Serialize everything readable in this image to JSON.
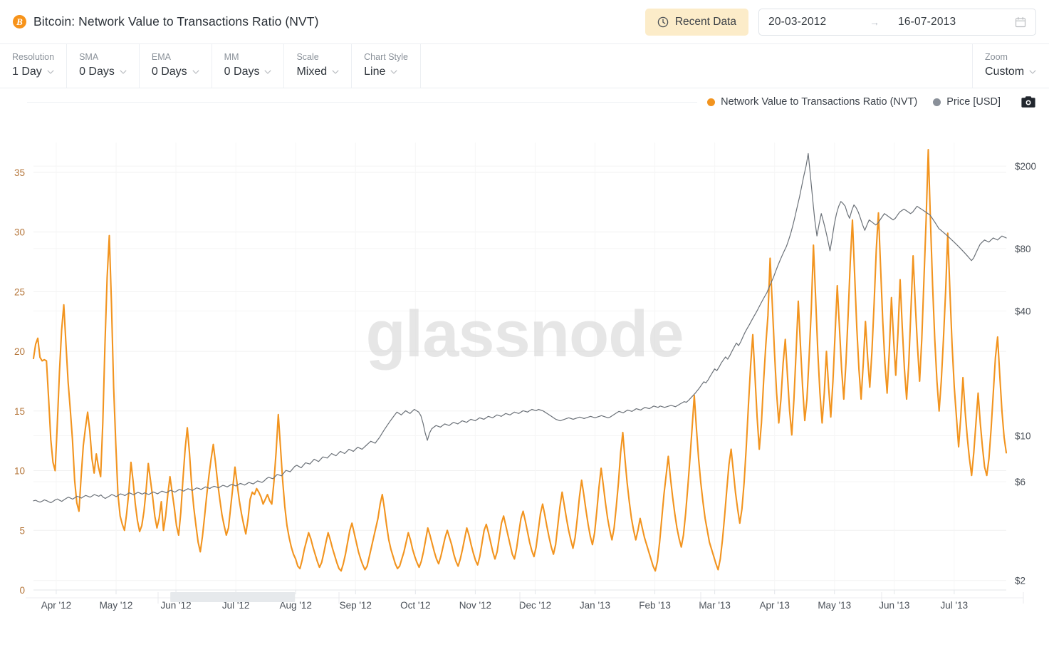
{
  "header": {
    "icon": "bitcoin-icon",
    "title": "Bitcoin: Network Value to Transactions Ratio (NVT)",
    "recent_data_label": "Recent Data",
    "recent_data_icon": "clock-icon",
    "date_from": "20-03-2012",
    "date_arrow": "→",
    "date_to": "16-07-2013",
    "calendar_icon": "calendar-icon"
  },
  "toolbar": {
    "items": [
      {
        "label": "Resolution",
        "value": "1 Day"
      },
      {
        "label": "SMA",
        "value": "0 Days"
      },
      {
        "label": "EMA",
        "value": "0 Days"
      },
      {
        "label": "MM",
        "value": "0 Days"
      },
      {
        "label": "Scale",
        "value": "Mixed"
      },
      {
        "label": "Chart Style",
        "value": "Line"
      }
    ],
    "zoom": {
      "label": "Zoom",
      "value": "Custom"
    }
  },
  "legend": {
    "items": [
      {
        "label": "Network Value to Transactions Ratio (NVT)",
        "color": "#f2941f"
      },
      {
        "label": "Price [USD]",
        "color": "#8a9099"
      }
    ],
    "camera_icon": "camera-icon"
  },
  "watermark": "glassnode",
  "chart_data": {
    "type": "line",
    "title": "Bitcoin: Network Value to Transactions Ratio (NVT)",
    "xlabel": "",
    "ylabel": "Network Value to Transactions Ratio (NVT)",
    "y2label": "Price [USD]",
    "grid": true,
    "legend_position": "top-right",
    "x_tick_labels": [
      "Apr '12",
      "May '12",
      "Jun '12",
      "Jul '12",
      "Aug '12",
      "Sep '12",
      "Oct '12",
      "Nov '12",
      "Dec '12",
      "Jan '13",
      "Feb '13",
      "Mar '13",
      "Apr '13",
      "May '13",
      "Jun '13",
      "Jul '13"
    ],
    "x_range": [
      "2012-03-20",
      "2013-07-16"
    ],
    "y_left": {
      "label": "NVT",
      "scale": "linear",
      "ticks": [
        0,
        5,
        10,
        15,
        20,
        25,
        30,
        35
      ],
      "ylim": [
        0,
        37.5
      ],
      "color": "#b5763a"
    },
    "y_right": {
      "label": "Price [USD]",
      "scale": "log",
      "ticks": [
        2,
        6,
        10,
        40,
        80,
        200
      ],
      "tick_labels": [
        "$2",
        "$6",
        "$10",
        "$40",
        "$80",
        "$200"
      ],
      "ylim": [
        1.8,
        260
      ],
      "color": "#4a5058"
    },
    "series": [
      {
        "name": "Network Value to Transactions Ratio (NVT)",
        "axis": "left",
        "color": "#f2941f",
        "width": 2.1,
        "values": [
          19.4,
          20.6,
          21.1,
          19.5,
          19.2,
          19.3,
          19.2,
          16.0,
          12.6,
          10.7,
          10.0,
          13.9,
          18.3,
          21.8,
          23.9,
          20.6,
          17.4,
          15.1,
          12.6,
          9.2,
          7.3,
          6.6,
          9.5,
          12.1,
          13.6,
          14.9,
          13.3,
          11.0,
          9.8,
          11.4,
          10.3,
          9.5,
          14.0,
          20.6,
          26.2,
          29.7,
          24.0,
          17.0,
          12.2,
          8.0,
          6.2,
          5.5,
          5.0,
          6.4,
          8.2,
          10.7,
          9.1,
          7.2,
          5.8,
          4.9,
          5.4,
          6.6,
          8.4,
          10.6,
          9.2,
          7.8,
          6.2,
          5.2,
          6.0,
          7.4,
          5.0,
          6.2,
          8.0,
          9.5,
          8.2,
          6.9,
          5.4,
          4.6,
          6.5,
          9.3,
          11.8,
          13.6,
          11.5,
          8.8,
          6.9,
          5.4,
          4.0,
          3.2,
          4.5,
          6.2,
          8.0,
          9.6,
          11.0,
          12.2,
          10.7,
          9.0,
          7.6,
          6.3,
          5.4,
          4.6,
          5.2,
          6.9,
          8.6,
          10.3,
          8.9,
          7.5,
          6.4,
          5.5,
          4.7,
          5.9,
          7.6,
          8.2,
          8.0,
          8.5,
          8.2,
          7.8,
          7.2,
          7.6,
          8.0,
          7.5,
          7.2,
          9.1,
          11.6,
          14.7,
          12.0,
          9.2,
          7.0,
          5.4,
          4.4,
          3.6,
          3.0,
          2.6,
          2.0,
          1.8,
          2.5,
          3.4,
          4.1,
          4.8,
          4.3,
          3.6,
          3.0,
          2.4,
          1.9,
          2.3,
          3.1,
          4.0,
          4.8,
          4.2,
          3.5,
          2.9,
          2.3,
          1.8,
          1.6,
          2.2,
          3.0,
          4.0,
          5.0,
          5.6,
          4.8,
          4.0,
          3.2,
          2.6,
          2.1,
          1.7,
          2.0,
          2.8,
          3.6,
          4.4,
          5.2,
          6.0,
          7.2,
          8.0,
          6.8,
          5.4,
          4.2,
          3.4,
          2.8,
          2.2,
          1.8,
          2.0,
          2.6,
          3.2,
          4.0,
          4.8,
          4.2,
          3.4,
          2.8,
          2.3,
          1.9,
          2.4,
          3.2,
          4.2,
          5.2,
          4.6,
          3.9,
          3.2,
          2.6,
          2.2,
          2.8,
          3.6,
          4.4,
          5.0,
          4.4,
          3.8,
          3.0,
          2.4,
          2.0,
          2.6,
          3.4,
          4.3,
          5.2,
          4.6,
          3.8,
          3.1,
          2.5,
          2.1,
          2.8,
          3.9,
          5.0,
          5.5,
          4.8,
          4.0,
          3.2,
          2.6,
          3.2,
          4.4,
          5.6,
          6.2,
          5.4,
          4.6,
          3.8,
          3.0,
          2.6,
          3.5,
          4.8,
          6.0,
          6.6,
          5.8,
          4.9,
          4.0,
          3.3,
          2.8,
          3.6,
          5.0,
          6.4,
          7.2,
          6.3,
          5.3,
          4.4,
          3.6,
          3.0,
          3.8,
          5.4,
          7.0,
          8.2,
          7.1,
          6.0,
          5.0,
          4.2,
          3.5,
          4.4,
          6.0,
          7.8,
          9.2,
          8.0,
          6.7,
          5.5,
          4.5,
          3.8,
          4.8,
          6.6,
          8.6,
          10.2,
          8.8,
          7.3,
          6.0,
          5.0,
          4.2,
          5.2,
          7.0,
          9.0,
          11.5,
          13.2,
          11.0,
          9.0,
          7.4,
          6.0,
          5.0,
          4.2,
          5.0,
          6.0,
          5.2,
          4.4,
          3.8,
          3.2,
          2.6,
          2.0,
          1.6,
          2.4,
          4.0,
          6.0,
          8.0,
          9.6,
          11.2,
          9.4,
          7.8,
          6.4,
          5.2,
          4.3,
          3.6,
          4.6,
          6.4,
          8.6,
          11.0,
          13.6,
          16.3,
          13.5,
          11.0,
          9.0,
          7.4,
          6.0,
          5.0,
          4.0,
          3.4,
          2.8,
          2.2,
          1.7,
          2.6,
          4.2,
          6.2,
          8.4,
          10.5,
          11.8,
          10.0,
          8.2,
          6.8,
          5.6,
          6.8,
          9.0,
          12.0,
          15.5,
          18.8,
          21.4,
          18.0,
          14.5,
          11.8,
          14.0,
          17.5,
          20.5,
          23.0,
          27.8,
          24.0,
          20.0,
          16.5,
          14.0,
          16.0,
          19.0,
          21.0,
          18.0,
          15.0,
          13.0,
          16.0,
          20.0,
          24.2,
          20.5,
          17.0,
          14.2,
          16.0,
          19.5,
          23.5,
          28.9,
          24.5,
          20.0,
          16.5,
          14.0,
          16.5,
          20.0,
          17.0,
          14.5,
          17.5,
          21.5,
          25.5,
          22.0,
          18.5,
          16.0,
          19.0,
          23.0,
          27.5,
          31.0,
          26.5,
          22.0,
          18.5,
          16.0,
          19.0,
          22.5,
          19.5,
          17.0,
          20.0,
          24.0,
          28.5,
          31.6,
          27.0,
          22.5,
          19.0,
          16.5,
          20.0,
          24.5,
          21.0,
          18.0,
          21.5,
          26.0,
          22.0,
          18.5,
          16.0,
          19.0,
          23.5,
          28.0,
          24.0,
          20.5,
          17.5,
          21.0,
          26.0,
          31.0,
          36.9,
          31.0,
          25.5,
          21.0,
          17.5,
          15.0,
          17.5,
          21.0,
          25.0,
          29.9,
          25.0,
          20.5,
          17.0,
          14.5,
          12.0,
          14.5,
          17.8,
          15.0,
          12.8,
          11.0,
          9.6,
          11.5,
          14.0,
          16.5,
          14.0,
          12.0,
          10.3,
          9.6,
          11.0,
          13.5,
          16.5,
          19.5,
          21.2,
          18.0,
          15.0,
          12.8,
          11.5
        ]
      },
      {
        "name": "Price [USD]",
        "axis": "right",
        "color": "#6b7178",
        "width": 1.2,
        "values": [
          4.85,
          4.88,
          4.82,
          4.78,
          4.83,
          4.9,
          4.86,
          4.8,
          4.75,
          4.82,
          4.9,
          4.95,
          4.88,
          4.82,
          4.9,
          4.98,
          5.05,
          5.0,
          4.94,
          5.02,
          5.1,
          5.06,
          5.0,
          5.08,
          5.15,
          5.1,
          5.05,
          5.12,
          5.2,
          5.15,
          5.1,
          5.18,
          5.05,
          4.98,
          5.05,
          5.12,
          5.2,
          5.15,
          5.08,
          5.16,
          5.24,
          5.2,
          5.14,
          5.22,
          5.3,
          5.25,
          5.18,
          5.26,
          5.33,
          5.28,
          5.22,
          5.3,
          5.25,
          5.2,
          5.28,
          5.35,
          5.3,
          5.24,
          5.32,
          5.4,
          5.36,
          5.3,
          5.38,
          5.45,
          5.4,
          5.34,
          5.42,
          5.5,
          5.46,
          5.4,
          5.48,
          5.55,
          5.5,
          5.44,
          5.52,
          5.6,
          5.56,
          5.5,
          5.58,
          5.66,
          5.62,
          5.56,
          5.64,
          5.7,
          5.66,
          5.6,
          5.68,
          5.76,
          5.72,
          5.66,
          5.74,
          5.82,
          5.78,
          5.72,
          5.8,
          5.88,
          5.84,
          5.78,
          5.86,
          5.95,
          5.9,
          5.85,
          5.95,
          6.05,
          6.0,
          5.95,
          6.05,
          6.2,
          6.3,
          6.25,
          6.2,
          6.35,
          6.5,
          6.45,
          6.4,
          6.6,
          6.8,
          6.75,
          6.7,
          6.9,
          7.1,
          7.2,
          7.1,
          7.0,
          7.2,
          7.4,
          7.35,
          7.3,
          7.5,
          7.7,
          7.6,
          7.5,
          7.7,
          7.9,
          7.85,
          7.8,
          8.0,
          8.2,
          8.1,
          8.0,
          8.2,
          8.4,
          8.3,
          8.2,
          8.4,
          8.6,
          8.5,
          8.4,
          8.6,
          8.8,
          8.7,
          8.6,
          8.8,
          9.0,
          9.2,
          9.4,
          9.3,
          9.2,
          9.5,
          9.8,
          10.2,
          10.6,
          11.0,
          11.4,
          11.8,
          12.2,
          12.6,
          13.0,
          12.8,
          12.6,
          12.9,
          13.2,
          13.0,
          12.8,
          13.1,
          13.4,
          13.2,
          13.0,
          12.5,
          11.5,
          10.3,
          9.5,
          10.3,
          10.8,
          11.0,
          11.2,
          11.1,
          11.0,
          11.2,
          11.4,
          11.3,
          11.2,
          11.4,
          11.6,
          11.5,
          11.4,
          11.6,
          11.8,
          11.7,
          11.6,
          11.8,
          12.0,
          11.9,
          11.8,
          12.0,
          12.2,
          12.1,
          12.0,
          12.2,
          12.4,
          12.3,
          12.2,
          12.4,
          12.6,
          12.5,
          12.4,
          12.6,
          12.8,
          12.7,
          12.6,
          12.8,
          13.0,
          12.9,
          12.8,
          13.0,
          13.2,
          13.1,
          13.0,
          13.2,
          13.4,
          13.3,
          13.2,
          13.4,
          13.3,
          13.2,
          13.0,
          12.8,
          12.6,
          12.4,
          12.2,
          12.0,
          11.9,
          11.8,
          11.9,
          12.0,
          12.1,
          12.2,
          12.1,
          12.0,
          12.1,
          12.2,
          12.3,
          12.2,
          12.1,
          12.2,
          12.3,
          12.4,
          12.3,
          12.2,
          12.3,
          12.4,
          12.5,
          12.4,
          12.3,
          12.2,
          12.3,
          12.5,
          12.7,
          12.9,
          13.1,
          13.0,
          12.9,
          13.1,
          13.3,
          13.2,
          13.1,
          13.3,
          13.5,
          13.4,
          13.3,
          13.5,
          13.7,
          13.6,
          13.5,
          13.7,
          13.9,
          13.8,
          13.7,
          13.9,
          13.8,
          13.7,
          13.8,
          13.9,
          14.0,
          13.9,
          13.8,
          14.0,
          14.2,
          14.4,
          14.6,
          14.5,
          14.8,
          15.2,
          15.6,
          16.0,
          16.5,
          17.0,
          17.6,
          18.2,
          18.0,
          18.6,
          19.4,
          20.2,
          21.0,
          20.6,
          21.4,
          22.4,
          23.2,
          24.0,
          23.4,
          24.4,
          25.6,
          26.8,
          28.0,
          27.2,
          28.4,
          30.0,
          31.6,
          33.0,
          34.4,
          36.0,
          37.6,
          39.2,
          41.0,
          43.0,
          45.0,
          47.0,
          49.0,
          52.0,
          55.0,
          58.0,
          62.0,
          66.0,
          70.0,
          74.0,
          78.0,
          82.0,
          88.0,
          95.0,
          104.0,
          115.0,
          128.0,
          142.0,
          160.0,
          180.0,
          200.0,
          230.0,
          180.0,
          140.0,
          110.0,
          92.0,
          105.0,
          118.0,
          108.0,
          98.0,
          88.0,
          78.0,
          90.0,
          105.0,
          118.0,
          128.0,
          135.0,
          132.0,
          128.0,
          118.0,
          112.0,
          122.0,
          130.0,
          126.0,
          120.0,
          112.0,
          104.0,
          98.0,
          104.0,
          110.0,
          108.0,
          106.0,
          104.0,
          106.0,
          110.0,
          114.0,
          118.0,
          116.0,
          114.0,
          112.0,
          110.0,
          112.0,
          116.0,
          120.0,
          122.0,
          124.0,
          122.0,
          120.0,
          118.0,
          120.0,
          124.0,
          128.0,
          126.0,
          124.0,
          122.0,
          120.0,
          118.0,
          116.0,
          112.0,
          108.0,
          104.0,
          100.0,
          98.0,
          96.0,
          94.0,
          92.0,
          90.0,
          88.0,
          86.0,
          84.0,
          82.0,
          80.0,
          78.0,
          76.0,
          74.0,
          72.0,
          70.0,
          72.0,
          76.0,
          80.0,
          84.0,
          86.0,
          88.0,
          87.0,
          86.0,
          88.0,
          90.0,
          89.0,
          88.0,
          90.0,
          92.0,
          91.0,
          90.0
        ]
      }
    ]
  },
  "navigator": {
    "selection_start_pct": 14.5,
    "selection_end_pct": 27.0
  }
}
